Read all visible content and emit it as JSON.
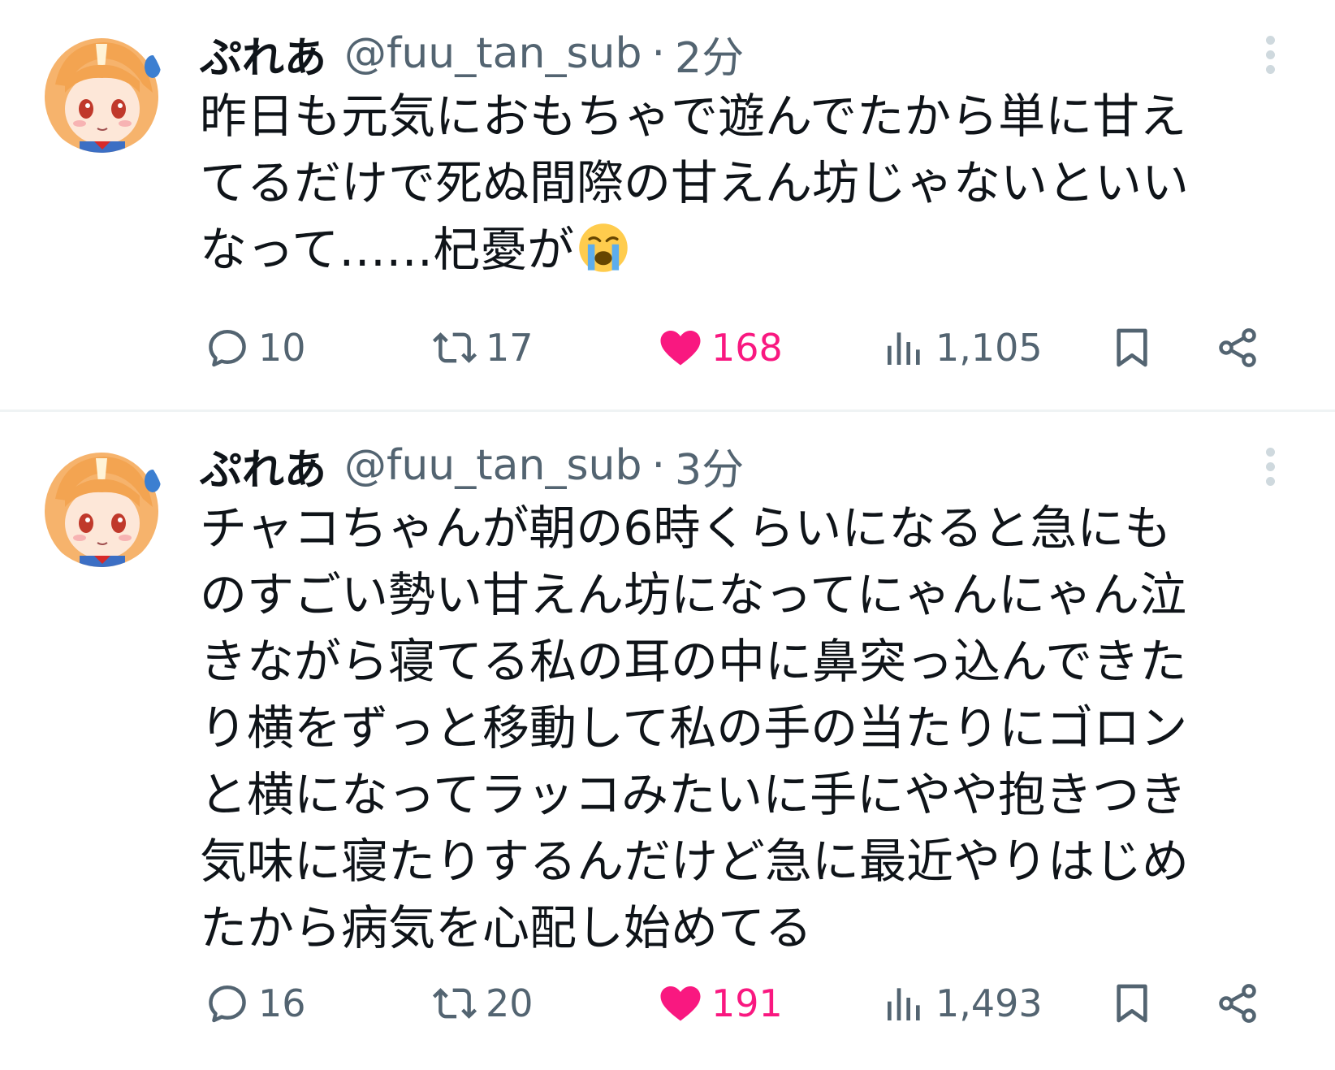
{
  "tweets": [
    {
      "author_name": "ぷれあ",
      "handle": "@fuu_tan_sub",
      "separator": "·",
      "time": "2分",
      "text_lines": [
        "昨日も元気におもちゃで遊んでたから単に甘え",
        "てるだけで死ぬ間際の甘えん坊じゃないといい",
        "なって……杞憂が"
      ],
      "emoji": "loudly-crying-face-emoji",
      "replies": "10",
      "retweets": "17",
      "likes": "168",
      "views": "1,105",
      "liked": true
    },
    {
      "author_name": "ぷれあ",
      "handle": "@fuu_tan_sub",
      "separator": "·",
      "time": "3分",
      "text_lines": [
        "チャコちゃんが朝の6時くらいになると急にも",
        "のすごい勢い甘えん坊になってにゃんにゃん泣",
        "きながら寝てる私の耳の中に鼻突っ込んできた",
        "り横をずっと移動して私の手の当たりにゴロン",
        "と横になってラッコみたいに手にやや抱きつき",
        "気味に寝たりするんだけど急に最近やりはじめ",
        "たから病気を心配し始めてる"
      ],
      "replies": "16",
      "retweets": "20",
      "likes": "191",
      "views": "1,493",
      "liked": true
    }
  ],
  "colors": {
    "text": "#0f1419",
    "secondary": "#536471",
    "like_pink": "#f91880",
    "divider": "#eff3f4"
  },
  "icons": [
    "reply-icon",
    "retweet-icon",
    "heart-icon",
    "views-icon",
    "bookmark-icon",
    "share-icon",
    "more-icon"
  ]
}
